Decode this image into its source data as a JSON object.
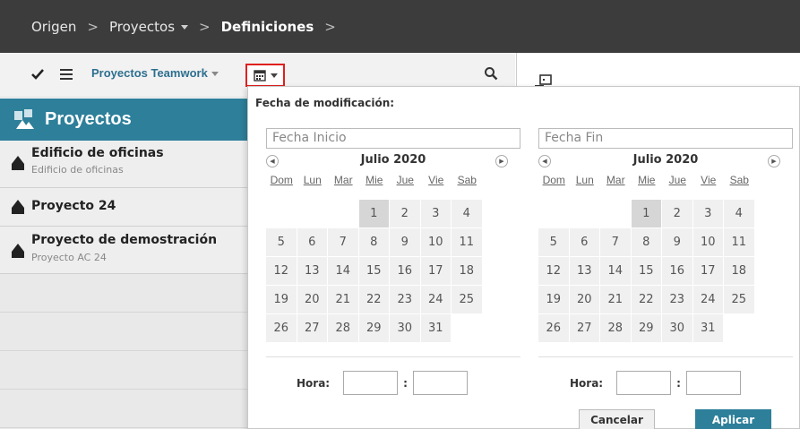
{
  "breadcrumb": {
    "items": [
      "Origen",
      "Proyectos",
      "Definiciones"
    ],
    "separator": ">"
  },
  "toolbar": {
    "filter_label": "Proyectos Teamwork"
  },
  "list": {
    "header": "Proyectos",
    "items": [
      {
        "title": "Edificio de oficinas",
        "subtitle": "Edificio de oficinas"
      },
      {
        "title": "Proyecto 24",
        "subtitle": ""
      },
      {
        "title": "Proyecto de demostración",
        "subtitle": "Proyecto AC 24"
      }
    ]
  },
  "popup": {
    "title": "Fecha de modificación:",
    "start": {
      "placeholder": "Fecha Inicio",
      "month": "Julio 2020",
      "weekdays": [
        "Dom",
        "Lun",
        "Mar",
        "Mie",
        "Jue",
        "Vie",
        "Sab"
      ],
      "hora_label": "Hora:",
      "hora_sep": ":"
    },
    "end": {
      "placeholder": "Fecha Fin",
      "month": "Julio 2020",
      "weekdays": [
        "Dom",
        "Lun",
        "Mar",
        "Mie",
        "Jue",
        "Vie",
        "Sab"
      ],
      "hora_label": "Hora:",
      "hora_sep": ":"
    },
    "days": [
      "1",
      "2",
      "3",
      "4",
      "5",
      "6",
      "7",
      "8",
      "9",
      "10",
      "11",
      "12",
      "13",
      "14",
      "15",
      "16",
      "17",
      "18",
      "19",
      "20",
      "21",
      "22",
      "23",
      "24",
      "25",
      "26",
      "27",
      "28",
      "29",
      "30",
      "31"
    ],
    "first_weekday_index": 3,
    "highlighted_day": "1",
    "buttons": {
      "cancel": "Cancelar",
      "apply": "Aplicar"
    }
  },
  "colors": {
    "accent": "#2d7f9a",
    "topbar": "#3c3c3c",
    "highlight_border": "#e0201e"
  }
}
